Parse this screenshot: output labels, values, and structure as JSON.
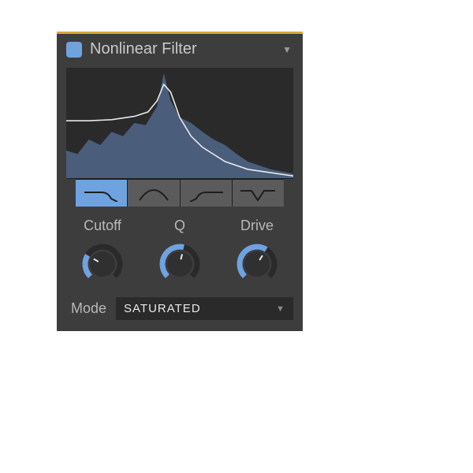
{
  "header": {
    "title": "Nonlinear Filter",
    "enabled": true,
    "accent": "#6fa3e0"
  },
  "filter_types": {
    "selected_index": 0,
    "items": [
      {
        "name": "lowpass"
      },
      {
        "name": "bandpass"
      },
      {
        "name": "highpass"
      },
      {
        "name": "notch"
      }
    ]
  },
  "knobs": {
    "cutoff": {
      "label": "Cutoff",
      "value": 0.28
    },
    "q": {
      "label": "Q",
      "value": 0.55
    },
    "drive": {
      "label": "Drive",
      "value": 0.62
    }
  },
  "mode": {
    "label": "Mode",
    "value": "SATURATED"
  },
  "colors": {
    "accent_top": "#d9a83a",
    "knob_fill": "#6fa3e0",
    "panel_bg": "#3d3d3d",
    "graph_bg": "#2a2a2a",
    "spectrum_fill": "#5a6f8c"
  },
  "chart_data": {
    "type": "area",
    "title": "",
    "xlabel": "",
    "ylabel": "",
    "series": [
      {
        "name": "filter-response",
        "x": [
          0,
          0.1,
          0.2,
          0.3,
          0.36,
          0.4,
          0.43,
          0.46,
          0.5,
          0.55,
          0.6,
          0.7,
          0.8,
          1.0
        ],
        "values": [
          0.52,
          0.52,
          0.53,
          0.56,
          0.6,
          0.7,
          0.85,
          0.78,
          0.55,
          0.38,
          0.28,
          0.15,
          0.08,
          0.02
        ]
      },
      {
        "name": "spectrum",
        "x": [
          0,
          0.05,
          0.1,
          0.15,
          0.2,
          0.25,
          0.3,
          0.35,
          0.4,
          0.43,
          0.46,
          0.5,
          0.55,
          0.6,
          0.65,
          0.7,
          0.75,
          0.8,
          0.9,
          1.0
        ],
        "values": [
          0.25,
          0.22,
          0.35,
          0.3,
          0.42,
          0.38,
          0.5,
          0.48,
          0.65,
          0.95,
          0.7,
          0.55,
          0.5,
          0.42,
          0.35,
          0.3,
          0.22,
          0.15,
          0.08,
          0.04
        ]
      }
    ],
    "xlim": [
      0,
      1
    ],
    "ylim": [
      0,
      1
    ]
  }
}
